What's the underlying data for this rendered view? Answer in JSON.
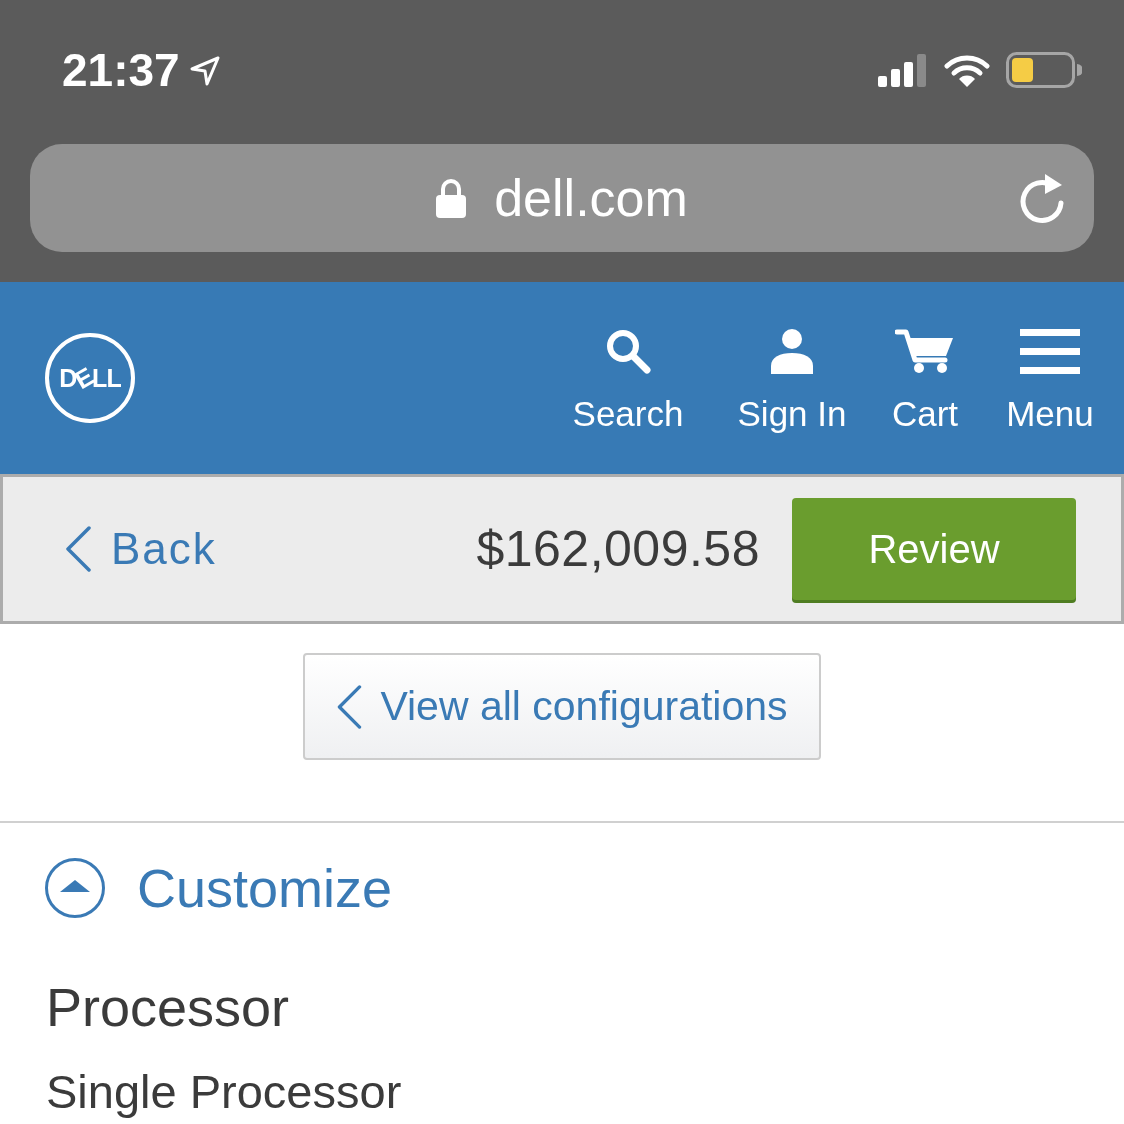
{
  "status_bar": {
    "time": "21:37"
  },
  "address_bar": {
    "url": "dell.com"
  },
  "header": {
    "logo": "DELL",
    "nav": [
      {
        "kind": "search",
        "label": "Search"
      },
      {
        "kind": "user",
        "label": "Sign In"
      },
      {
        "kind": "cart",
        "label": "Cart"
      },
      {
        "kind": "menu",
        "label": "Menu"
      }
    ]
  },
  "summary_bar": {
    "back": "Back",
    "price": "$162,009.58",
    "review": "Review"
  },
  "configurations_button": "View all configurations",
  "section": {
    "title": "Customize",
    "expanded": true,
    "heading": "Processor",
    "value": "Single Processor"
  }
}
